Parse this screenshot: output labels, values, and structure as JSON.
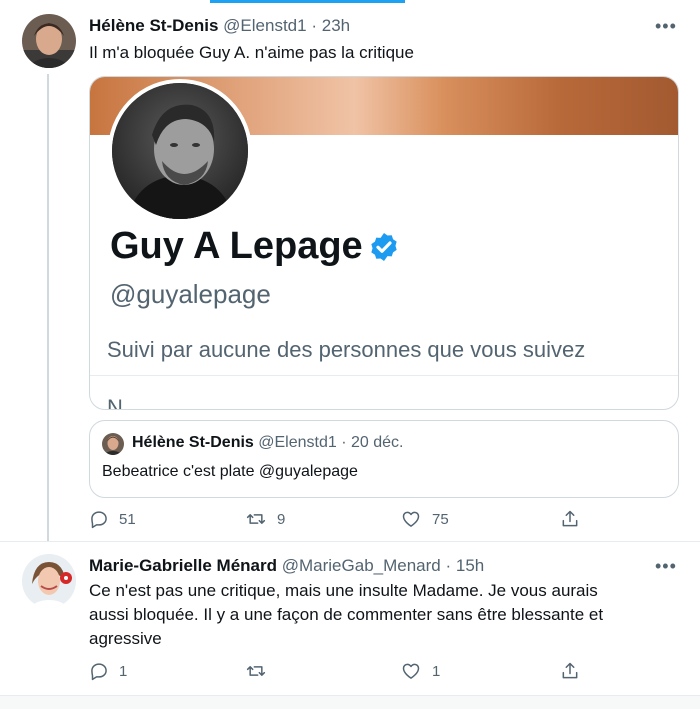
{
  "tweet1": {
    "author_name": "Hélène St-Denis",
    "handle": "@Elenstd1",
    "separator": "·",
    "time": "23h",
    "more": "•••",
    "text": "Il m'a bloquée Guy A. n'aime pas la critique",
    "card": {
      "name": "Guy A Lepage",
      "handle": "@guyalepage",
      "followed_by": "Suivi par aucune des personnes que vous suivez",
      "cut_text": "N"
    },
    "quote": {
      "author_name": "Hélène St-Denis",
      "handle": "@Elenstd1",
      "separator": "·",
      "time": "20 déc.",
      "text": "Bebeatrice c'est plate @guyalepage"
    },
    "actions": {
      "replies": "51",
      "retweets": "9",
      "likes": "75"
    }
  },
  "tweet2": {
    "author_name": "Marie-Gabrielle Ménard",
    "handle": "@MarieGab_Menard",
    "separator": "·",
    "time": "15h",
    "more": "•••",
    "text_lines": [
      "Ce n'est pas une critique, mais une insulte Madame. Je vous aurais",
      "aussi bloquée. Il y a une façon de commenter sans être blessante et",
      "agressive"
    ],
    "actions": {
      "replies": "1",
      "retweets": "",
      "likes": "1"
    }
  },
  "colors": {
    "accent": "#1da1f2",
    "muted": "#536471",
    "verified": "#1d9bf0"
  }
}
